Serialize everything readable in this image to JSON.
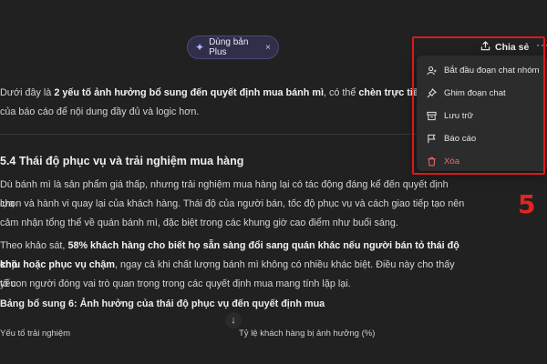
{
  "top_bar": {
    "plus_pill_label": "Dùng bản Plus",
    "plus_pill_close": "×",
    "share_label": "Chia sẻ",
    "more_label": "···"
  },
  "article": {
    "intro_prefix": "Dưới đây là ",
    "intro_bold1": "2 yếu tố ảnh hưởng bổ sung đến quyết định mua bánh mì",
    "intro_mid": ", có thể ",
    "intro_bold2": "chèn trực tiếp và",
    "intro_line2": "của báo cáo để nội dung đầy đủ và logic hơn.",
    "section_heading": "5.4 Thái độ phục vụ và trải nghiệm mua hàng",
    "para1_l1": "Dù bánh mì là sản phẩm giá thấp, nhưng trải nghiệm mua hàng lại có tác động đáng kể đến quyết định lựa",
    "para1_l2": "chọn và hành vi quay lại của khách hàng. Thái độ của người bán, tốc độ phục vụ và cách giao tiếp tạo nên",
    "para1_l3": "cảm nhận tổng thể về quán bánh mì, đặc biệt trong các khung giờ cao điểm như buổi sáng.",
    "para2_prefix": "Theo khảo sát, ",
    "para2_bold": "58% khách hàng cho biết họ sẵn sàng đổi sang quán khác nếu người bán tỏ thái độ khó",
    "para2_bold_l2": "chịu hoặc phục vụ chậm",
    "para2_rest_l2": ", ngay cả khi chất lượng bánh mì không có nhiều khác biệt. Điều này cho thấy yếu",
    "para2_l3": "tố con người đóng vai trò quan trọng trong các quyết định mua mang tính lặp lại.",
    "table_heading": "Bảng bổ sung 6: Ảnh hưởng của thái độ phục vụ đến quyết định mua",
    "col1": "Yếu tố trải nghiệm",
    "col2": "Tỷ lệ khách hàng bị ảnh hưởng (%)"
  },
  "menu": {
    "items": [
      {
        "label": "Bắt đầu đoạn chat nhóm",
        "icon": "group-icon"
      },
      {
        "label": "Ghim đoạn chat",
        "icon": "pin-icon"
      },
      {
        "label": "Lưu trữ",
        "icon": "archive-icon"
      },
      {
        "label": "Báo cáo",
        "icon": "flag-icon"
      },
      {
        "label": "Xóa",
        "icon": "trash-icon",
        "color": "#f26b6b"
      }
    ]
  },
  "annotation": {
    "step_number": "5",
    "color": "#e01818"
  }
}
